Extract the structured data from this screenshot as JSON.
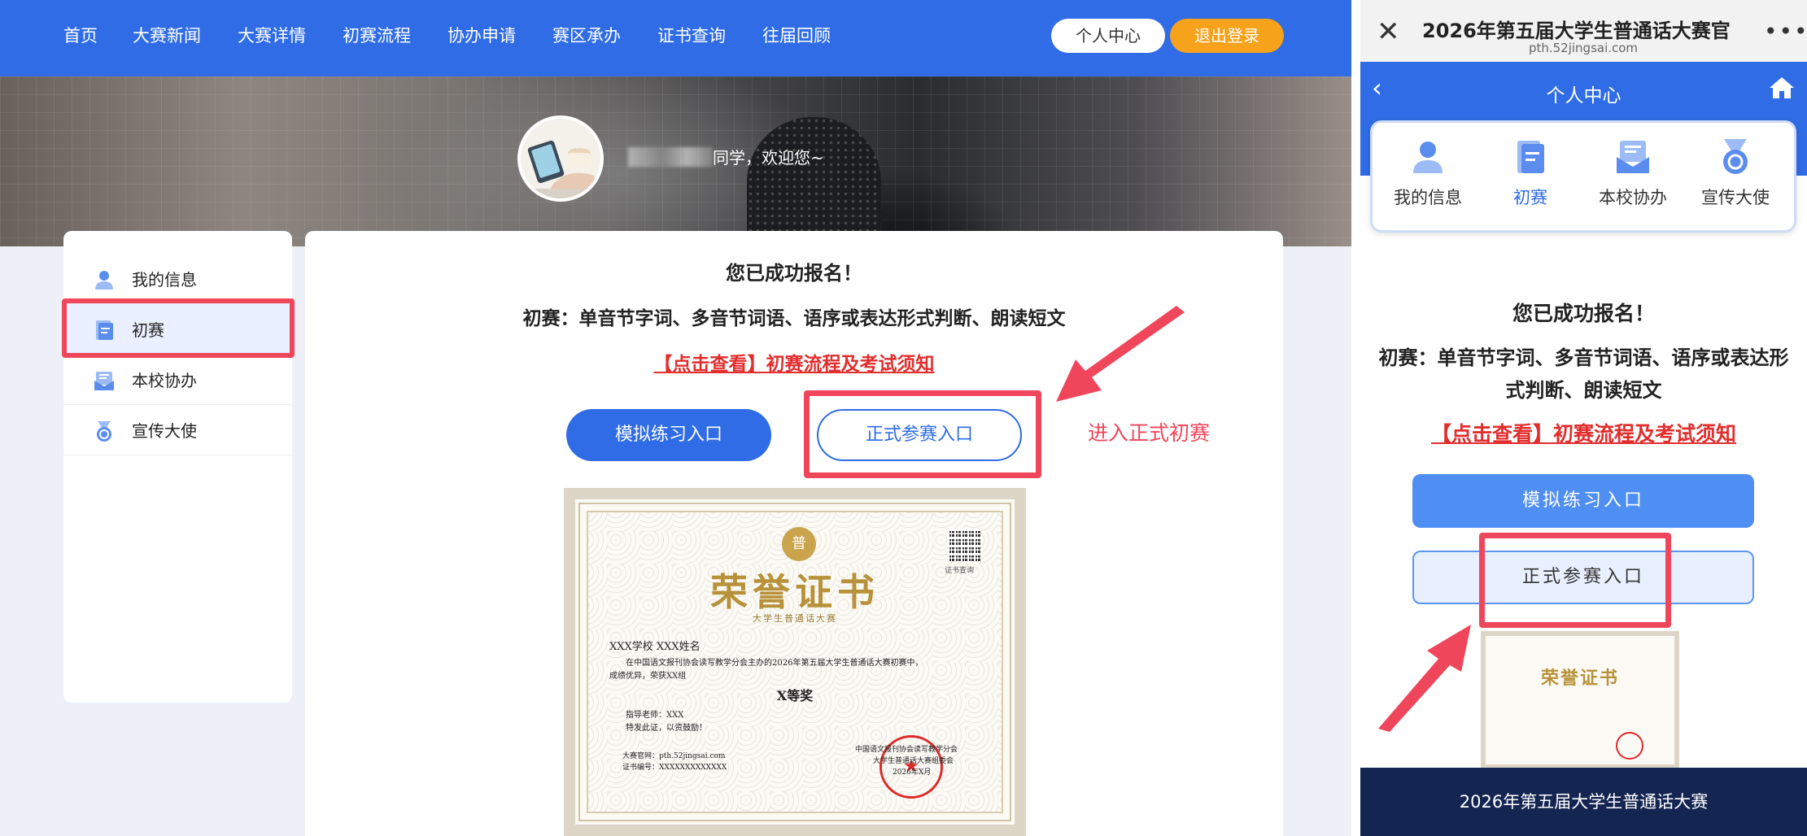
{
  "desktop": {
    "nav": [
      "首页",
      "大赛新闻",
      "大赛详情",
      "初赛流程",
      "协办申请",
      "赛区承办",
      "证书查询",
      "往届回顾"
    ],
    "personal_center": "个人中心",
    "logout": "退出登录",
    "greeting": "同学，欢迎您~",
    "sidebar": [
      {
        "label": "我的信息",
        "icon": "user-icon"
      },
      {
        "label": "初赛",
        "icon": "document-icon"
      },
      {
        "label": "本校协办",
        "icon": "mail-icon"
      },
      {
        "label": "宣传大使",
        "icon": "medal-icon"
      }
    ],
    "main": {
      "success": "您已成功报名！",
      "description": "初赛：单音节字词、多音节词语、语序或表达形式判断、朗读短文",
      "link": "【点击查看】初赛流程及考试须知",
      "mock_button": "模拟练习入口",
      "formal_button": "正式参赛入口",
      "annotation": "进入正式初赛"
    },
    "certificate": {
      "title": "荣誉证书",
      "subtitle": "大学生普通话大赛",
      "badge": "普",
      "qr_label": "证书查询",
      "recipient": "XXX学校  XXX姓名",
      "body_line1": "在中国语文报刊协会读写教学分会主办的2026年第五届大学生普通话大赛初赛中，",
      "body_line2": "成绩优异，荣获XX组",
      "award": "X等奖",
      "teacher": "指导老师：XXX",
      "encourage": "特发此证，以资鼓励！",
      "website": "大赛官网：pth.52jingsai.com",
      "cert_no": "证书编号：XXXXXXXXXXXXX",
      "org_line1": "中国语文报刊协会读写教学分会",
      "org_line2": "大学生普通话大赛组委会",
      "date": "2026年X月"
    }
  },
  "mobile": {
    "page_title": "2026年第五届大学生普通话大赛官",
    "url": "pth.52jingsai.com",
    "header_title": "个人中心",
    "tabs": [
      {
        "label": "我的信息",
        "icon": "user-icon"
      },
      {
        "label": "初赛",
        "icon": "document-icon"
      },
      {
        "label": "本校协办",
        "icon": "mail-icon"
      },
      {
        "label": "宣传大使",
        "icon": "medal-icon"
      }
    ],
    "success": "您已成功报名！",
    "description": "初赛：单音节字词、多音节词语、语序或表达形式判断、朗读短文",
    "link": "【点击查看】初赛流程及考试须知",
    "mock_button": "模拟练习入口",
    "formal_button": "正式参赛入口",
    "certificate_title": "荣誉证书",
    "footer": "2026年第五届大学生普通话大赛"
  },
  "colors": {
    "primary": "#2f6ce5",
    "accent": "#f7a21b",
    "highlight": "#f0465b",
    "link": "#e22d2d",
    "gold": "#b8923a",
    "footer": "#142552"
  }
}
